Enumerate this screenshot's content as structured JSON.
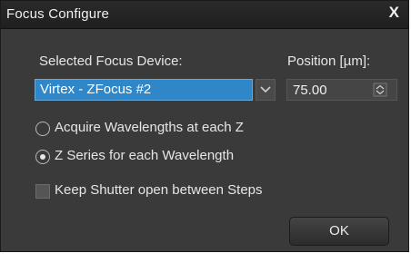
{
  "window": {
    "title": "Focus Configure",
    "close_glyph": "X"
  },
  "device": {
    "label": "Selected Focus Device:",
    "selected_value": "Virtex - ZFocus #2"
  },
  "position": {
    "label": "Position [µm]:",
    "value": "75.00"
  },
  "acquisition_mode": {
    "options": [
      {
        "label": "Acquire Wavelengths at each Z",
        "selected": false
      },
      {
        "label": "Z Series for each Wavelength",
        "selected": true
      }
    ]
  },
  "shutter": {
    "label": "Keep Shutter open between Steps",
    "checked": false
  },
  "buttons": {
    "ok_label": "OK"
  },
  "colors": {
    "background": "#3a3a3a",
    "selection": "#2f86c8"
  },
  "icons": [
    "close-icon",
    "chevron-down-icon",
    "spinner-icon",
    "radio-dot-icon"
  ]
}
